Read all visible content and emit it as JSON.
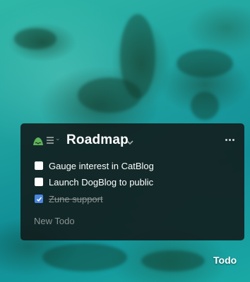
{
  "background": {
    "description_color": "#1fa2a0"
  },
  "widget": {
    "app_icon": "basecamp-icon",
    "list_icon": "list-icon",
    "title": "Roadmap",
    "todos": [
      {
        "label": "Gauge interest in CatBlog",
        "checked": false
      },
      {
        "label": "Launch DogBlog to public",
        "checked": false
      },
      {
        "label": "Zune support",
        "checked": true
      }
    ],
    "new_todo_placeholder": "New Todo",
    "accent_color": "#4a86e0"
  },
  "tab": {
    "label": "Todo"
  }
}
